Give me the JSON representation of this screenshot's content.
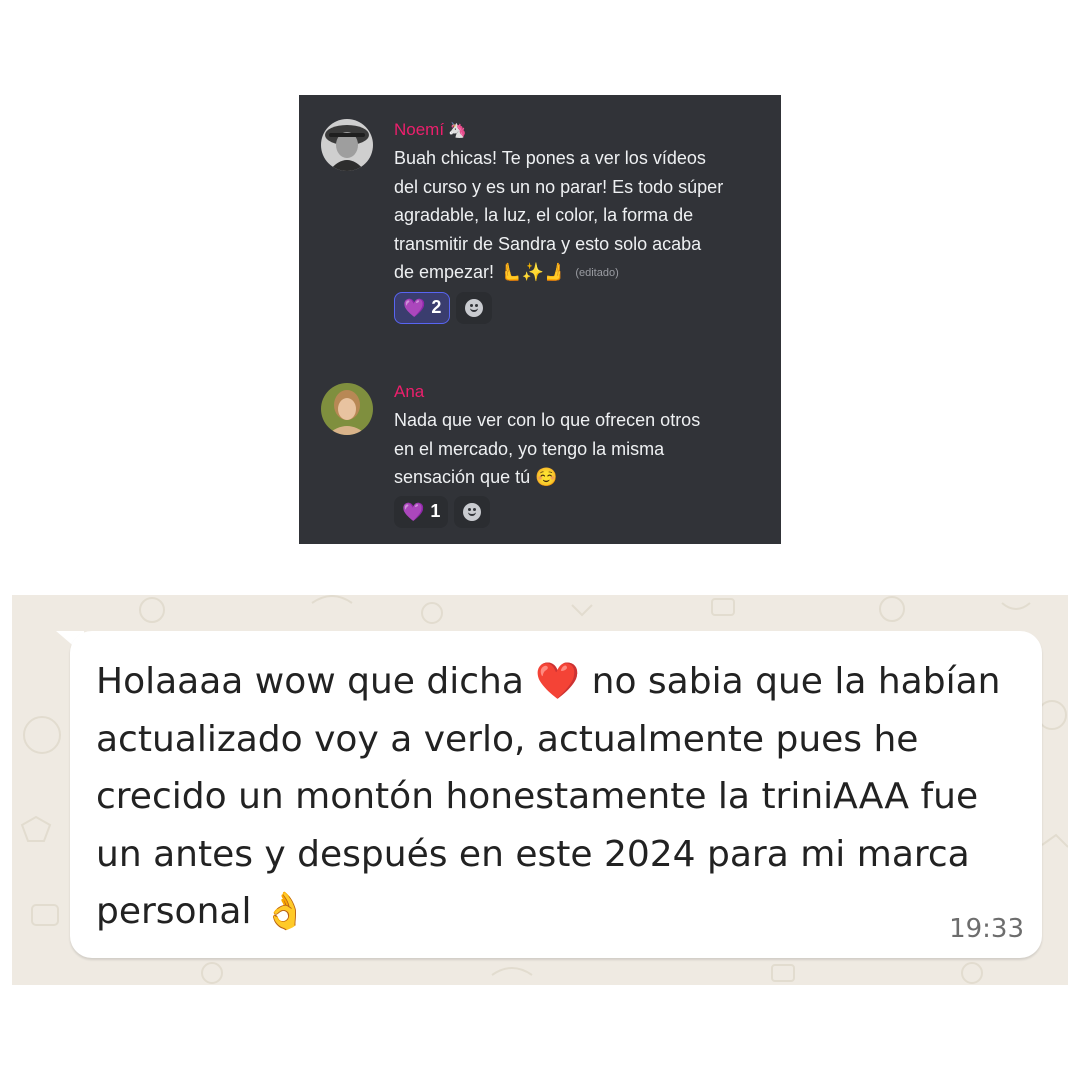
{
  "discord": {
    "messages": [
      {
        "username": "Noemí",
        "username_emoji": "🦄",
        "text": "Buah chicas! Te pones a ver los vídeos del curso y es un no parar! Es todo súper agradable, la luz, el color, la forma de transmitir de Sandra y esto solo acaba de empezar! 🫷✨🫸",
        "edited_label": "(editado)",
        "reaction": {
          "emoji": "💜",
          "count": "2"
        }
      },
      {
        "username": "Ana",
        "text": "Nada que ver con lo que ofrecen otros en el mercado, yo tengo la misma sensación que tú ☺️",
        "reaction": {
          "emoji": "💜",
          "count": "1"
        }
      }
    ],
    "colors": {
      "background": "#313338",
      "username": "#ec1f6c",
      "reaction_active_border": "#5865f2"
    }
  },
  "whatsapp": {
    "text": "Holaaaa wow que dicha ❤️ no sabia que la habían actualizado voy a verlo, actualmente pues he crecido un montón honestamente la triniAAA fue un antes y después en este 2024 para mi marca personal 👌",
    "time": "19:33",
    "colors": {
      "background": "#efeae2",
      "bubble": "#ffffff"
    }
  },
  "icons": {
    "add_reaction": "smiley-face-icon",
    "heart": "purple-heart-icon"
  }
}
